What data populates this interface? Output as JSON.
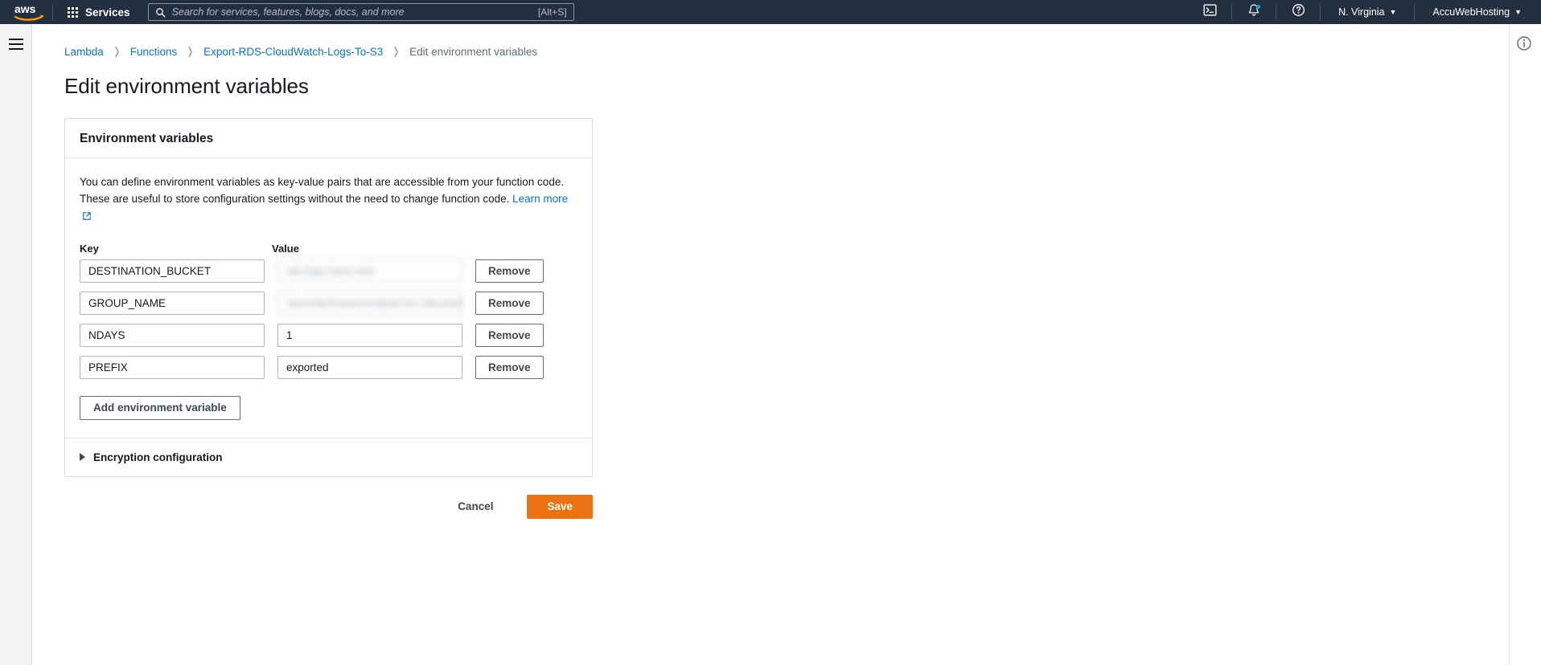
{
  "topnav": {
    "logo_name": "aws-logo",
    "services_label": "Services",
    "search": {
      "placeholder": "Search for services, features, blogs, docs, and more",
      "shortcut": "[Alt+S]",
      "value": ""
    },
    "cloudshell_icon": "cloudshell-terminal-icon",
    "notifications_icon": "bell-icon",
    "help_icon": "help-circle-icon",
    "region_label": "N. Virginia",
    "account_label": "AccuWebHosting",
    "caret": "▼"
  },
  "left_rail": {
    "menu_icon": "hamburger-menu-icon"
  },
  "right_rail": {
    "info_icon": "info-circle-icon"
  },
  "breadcrumb": {
    "separator": "❯",
    "items": [
      {
        "label": "Lambda",
        "current": false
      },
      {
        "label": "Functions",
        "current": false
      },
      {
        "label": "Export-RDS-CloudWatch-Logs-To-S3",
        "current": false
      },
      {
        "label": "Edit environment variables",
        "current": true
      }
    ]
  },
  "page": {
    "title": "Edit environment variables"
  },
  "card": {
    "heading": "Environment variables",
    "description_part1": "You can define environment variables as key-value pairs that are accessible from your function code. These are useful to store configuration settings without the need to change function code. ",
    "learn_more_label": "Learn more",
    "external_icon": "external-link-icon",
    "columns": {
      "key": "Key",
      "value": "Value"
    },
    "rows": [
      {
        "key": "DESTINATION_BUCKET",
        "value": "rds-logs-harry-test",
        "blurred": true,
        "remove_label": "Remove"
      },
      {
        "key": "GROUP_NAME",
        "value": "/aws/rds/instance/sqlserver-vibcorediv",
        "blurred": true,
        "remove_label": "Remove"
      },
      {
        "key": "NDAYS",
        "value": "1",
        "blurred": false,
        "remove_label": "Remove"
      },
      {
        "key": "PREFIX",
        "value": "exported",
        "blurred": false,
        "remove_label": "Remove"
      }
    ],
    "add_button_label": "Add environment variable",
    "encryption_label": "Encryption configuration",
    "encryption_expander_icon": "triangle-right-icon"
  },
  "actions": {
    "cancel_label": "Cancel",
    "save_label": "Save"
  },
  "colors": {
    "nav_bg": "#232f3e",
    "link": "#0972d3",
    "save_orange": "#ec7211",
    "notification_dot": "#00a8e1",
    "text": "#16191f",
    "muted_text": "#5f6b7a"
  }
}
